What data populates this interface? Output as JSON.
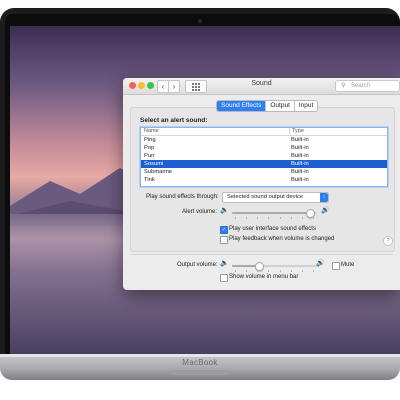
{
  "device": {
    "label": "MacBook"
  },
  "window": {
    "title": "Sound",
    "search_placeholder": "Search",
    "nav_back_icon": "chevron-left-icon",
    "nav_forward_icon": "chevron-right-icon",
    "show_all_icon": "grid-icon"
  },
  "tabs": [
    {
      "label": "Sound Effects",
      "active": true
    },
    {
      "label": "Output",
      "active": false
    },
    {
      "label": "Input",
      "active": false
    }
  ],
  "alerts": {
    "section_label": "Select an alert sound:",
    "columns": [
      "Name",
      "Type"
    ],
    "rows": [
      {
        "name": "Ping",
        "type": "Built-in",
        "selected": false
      },
      {
        "name": "Pop",
        "type": "Built-in",
        "selected": false
      },
      {
        "name": "Purr",
        "type": "Built-in",
        "selected": false
      },
      {
        "name": "Sosumi",
        "type": "Built-in",
        "selected": true
      },
      {
        "name": "Submarine",
        "type": "Built-in",
        "selected": false
      },
      {
        "name": "Tink",
        "type": "Built-in",
        "selected": false
      }
    ]
  },
  "play_through": {
    "label": "Play sound effects through:",
    "value": "Selected sound output device"
  },
  "alert_volume": {
    "label": "Alert volume:",
    "level": 0.95
  },
  "checkboxes": [
    {
      "label": "Play user interface sound effects",
      "checked": true
    },
    {
      "label": "Play feedback when volume is changed",
      "checked": false
    }
  ],
  "output_volume": {
    "label": "Output volume:",
    "level": 0.3
  },
  "mute": {
    "label": "Mute",
    "checked": false
  },
  "show_volume": {
    "label": "Show volume in menu bar",
    "checked": false
  },
  "help": {
    "label": "?"
  },
  "colors": {
    "accent": "#2d7ff3",
    "selection": "#1b5fd1"
  }
}
